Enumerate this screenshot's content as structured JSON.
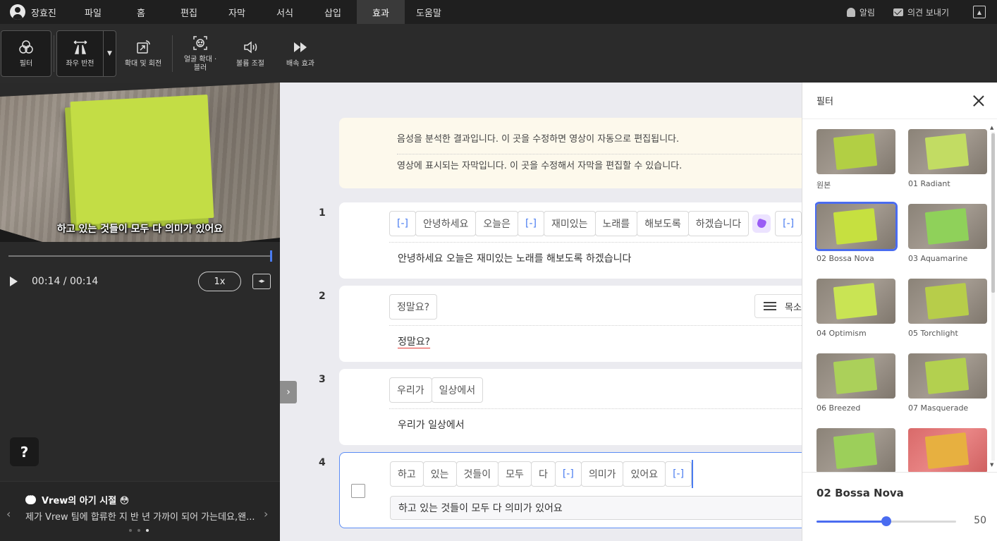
{
  "menubar": {
    "user_name": "장효진",
    "items": [
      "파일",
      "홈",
      "편집",
      "자막",
      "서식",
      "삽입",
      "효과",
      "도움말"
    ],
    "active": "효과",
    "notification_label": "알림",
    "feedback_label": "의견 보내기",
    "collapse_glyph": "▲"
  },
  "toolbar": {
    "filter_label": "필터",
    "flip_label": "좌우 반전",
    "flip_caret": "▼",
    "zoom_rotate_label": "확대 및 회전",
    "face_zoom_label_1": "얼굴 확대 ·",
    "face_zoom_label_2": "블러",
    "volume_label": "볼륨 조절",
    "speed_label": "배속 효과"
  },
  "player": {
    "subtitle_overlay": "하고 있는 것들이 모두 다 의미가 있어요",
    "progress": 1.0,
    "time": "00:14 / 00:14",
    "speed": "1x",
    "fit_glyph": "◂▸"
  },
  "help": {
    "label": "?"
  },
  "news": {
    "title": "Vrew의 아기 시절 😳",
    "body": "제가 Vrew 팀에 합류한 지 반 년 가까이 되어 가는데요,왠...",
    "prev_glyph": "‹",
    "next_glyph": "›",
    "dots": 3,
    "active_dot": 2
  },
  "editor": {
    "expand_glyph": "›",
    "info_lines": [
      "음성을 분석한 결과입니다. 이 곳을 수정하면 영상이 자동으로 편집됩니다.",
      "영상에 표시되는 자막입니다. 이 곳을 수정해서 자막을 편집할 수 있습니다."
    ],
    "clips": [
      {
        "number": "1",
        "words": [
          "[-]",
          "안녕하세요",
          "오늘은",
          "[-]",
          "재미있는",
          "노래를",
          "해보도록",
          "하겠습니다",
          "[-]"
        ],
        "subtitle": "안녕하세요 오늘은 재미있는 노래를 해보도록 하겠습니다"
      },
      {
        "number": "2",
        "words": [
          "정말요?"
        ],
        "subtitle": "정말요?",
        "voice_button": "목소리"
      },
      {
        "number": "3",
        "words": [
          "우리가",
          "일상에서"
        ],
        "subtitle": "우리가 일상에서"
      },
      {
        "number": "4",
        "words": [
          "하고",
          "있는",
          "것들이",
          "모두",
          "다",
          "[-]",
          "의미가",
          "있어요",
          "[-]"
        ],
        "subtitle": "하고 있는 것들이 모두 다 의미가 있어요"
      }
    ]
  },
  "filter_panel": {
    "title": "필터",
    "filters": [
      {
        "name": "원본",
        "color": "#b2cf44"
      },
      {
        "name": "01 Radiant",
        "color": "#c2dc63"
      },
      {
        "name": "02 Bossa Nova",
        "color": "#c6e040"
      },
      {
        "name": "03 Aquamarine",
        "color": "#8fd15a"
      },
      {
        "name": "04 Optimism",
        "color": "#c9e454"
      },
      {
        "name": "05 Torchlight",
        "color": "#b7cd4a"
      },
      {
        "name": "06 Breezed",
        "color": "#abd05a"
      },
      {
        "name": "07 Masquerade",
        "color": "#b3d04f"
      },
      {
        "name": "",
        "color": "#9ccf5a"
      },
      {
        "name": "",
        "color": "#e7b040"
      }
    ],
    "selected_index": 2,
    "selected_name": "02 Bossa Nova",
    "intensity": 50,
    "intensity_max": 100
  },
  "colors": {
    "accent": "#4a6cf0",
    "silence": "#4a7cf0",
    "paper": "#c3dd45"
  }
}
